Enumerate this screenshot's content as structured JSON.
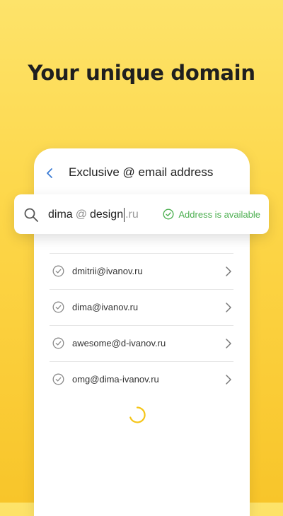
{
  "headline": "Your unique domain",
  "phone": {
    "title": "Exclusive @ email address",
    "back_icon": "chevron-left-icon"
  },
  "search": {
    "name_part": "dima",
    "at_symbol": "@",
    "domain_part": "design",
    "tld": ".ru",
    "status": "Address is available",
    "status_color": "#4caf50"
  },
  "suggestions": [
    {
      "address": "dmitrii@ivanov.ru"
    },
    {
      "address": "dima@ivanov.ru"
    },
    {
      "address": "awesome@d-ivanov.ru"
    },
    {
      "address": "omg@dima-ivanov.ru"
    }
  ],
  "colors": {
    "accent": "#f8c52a",
    "spinner": "#f5c518"
  }
}
